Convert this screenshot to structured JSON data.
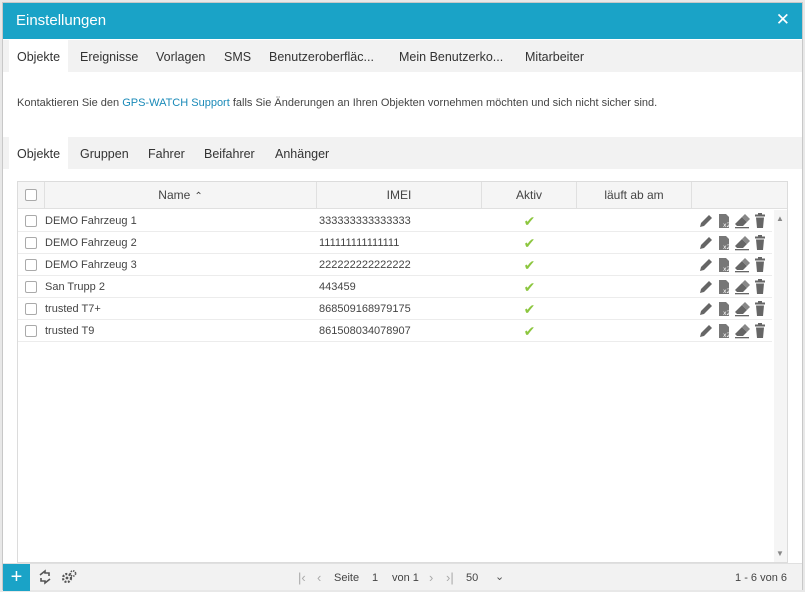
{
  "dialog": {
    "title": "Einstellungen",
    "close_label": "✕"
  },
  "tabs": [
    "Objekte",
    "Ereignisse",
    "Vorlagen",
    "SMS",
    "Benutzeroberfläc...",
    "Mein Benutzerko...",
    "Mitarbeiter"
  ],
  "notice": {
    "prefix": "Kontaktieren Sie den",
    "link": "GPS-WATCH Support",
    "suffix": "falls Sie Änderungen an Ihren Objekten vornehmen möchten und sich nicht sicher sind."
  },
  "subtabs": [
    "Objekte",
    "Gruppen",
    "Fahrer",
    "Beifahrer",
    "Anhänger"
  ],
  "table": {
    "columns": {
      "name": "Name",
      "imei": "IMEI",
      "aktiv": "Aktiv",
      "expires": "läuft ab am"
    },
    "rows": [
      {
        "name": "DEMO Fahrzeug 1",
        "imei": "333333333333333",
        "aktiv": true,
        "expires": ""
      },
      {
        "name": "DEMO Fahrzeug 2",
        "imei": "111111111111111",
        "aktiv": true,
        "expires": ""
      },
      {
        "name": "DEMO Fahrzeug 3",
        "imei": "222222222222222",
        "aktiv": true,
        "expires": ""
      },
      {
        "name": "San Trupp 2",
        "imei": "443459",
        "aktiv": true,
        "expires": ""
      },
      {
        "name": "trusted T7+",
        "imei": "868509168979175",
        "aktiv": true,
        "expires": ""
      },
      {
        "name": "trusted T9",
        "imei": "861508034078907",
        "aktiv": true,
        "expires": ""
      }
    ]
  },
  "footer": {
    "add_label": "+",
    "page_label": "Seite",
    "page_value": "1",
    "of_label": "von 1",
    "page_size": "50",
    "range": "1 - 6 von 6"
  },
  "colors": {
    "accent": "#1aa3c7",
    "check": "#8cc63f",
    "link": "#1a8ab8"
  }
}
